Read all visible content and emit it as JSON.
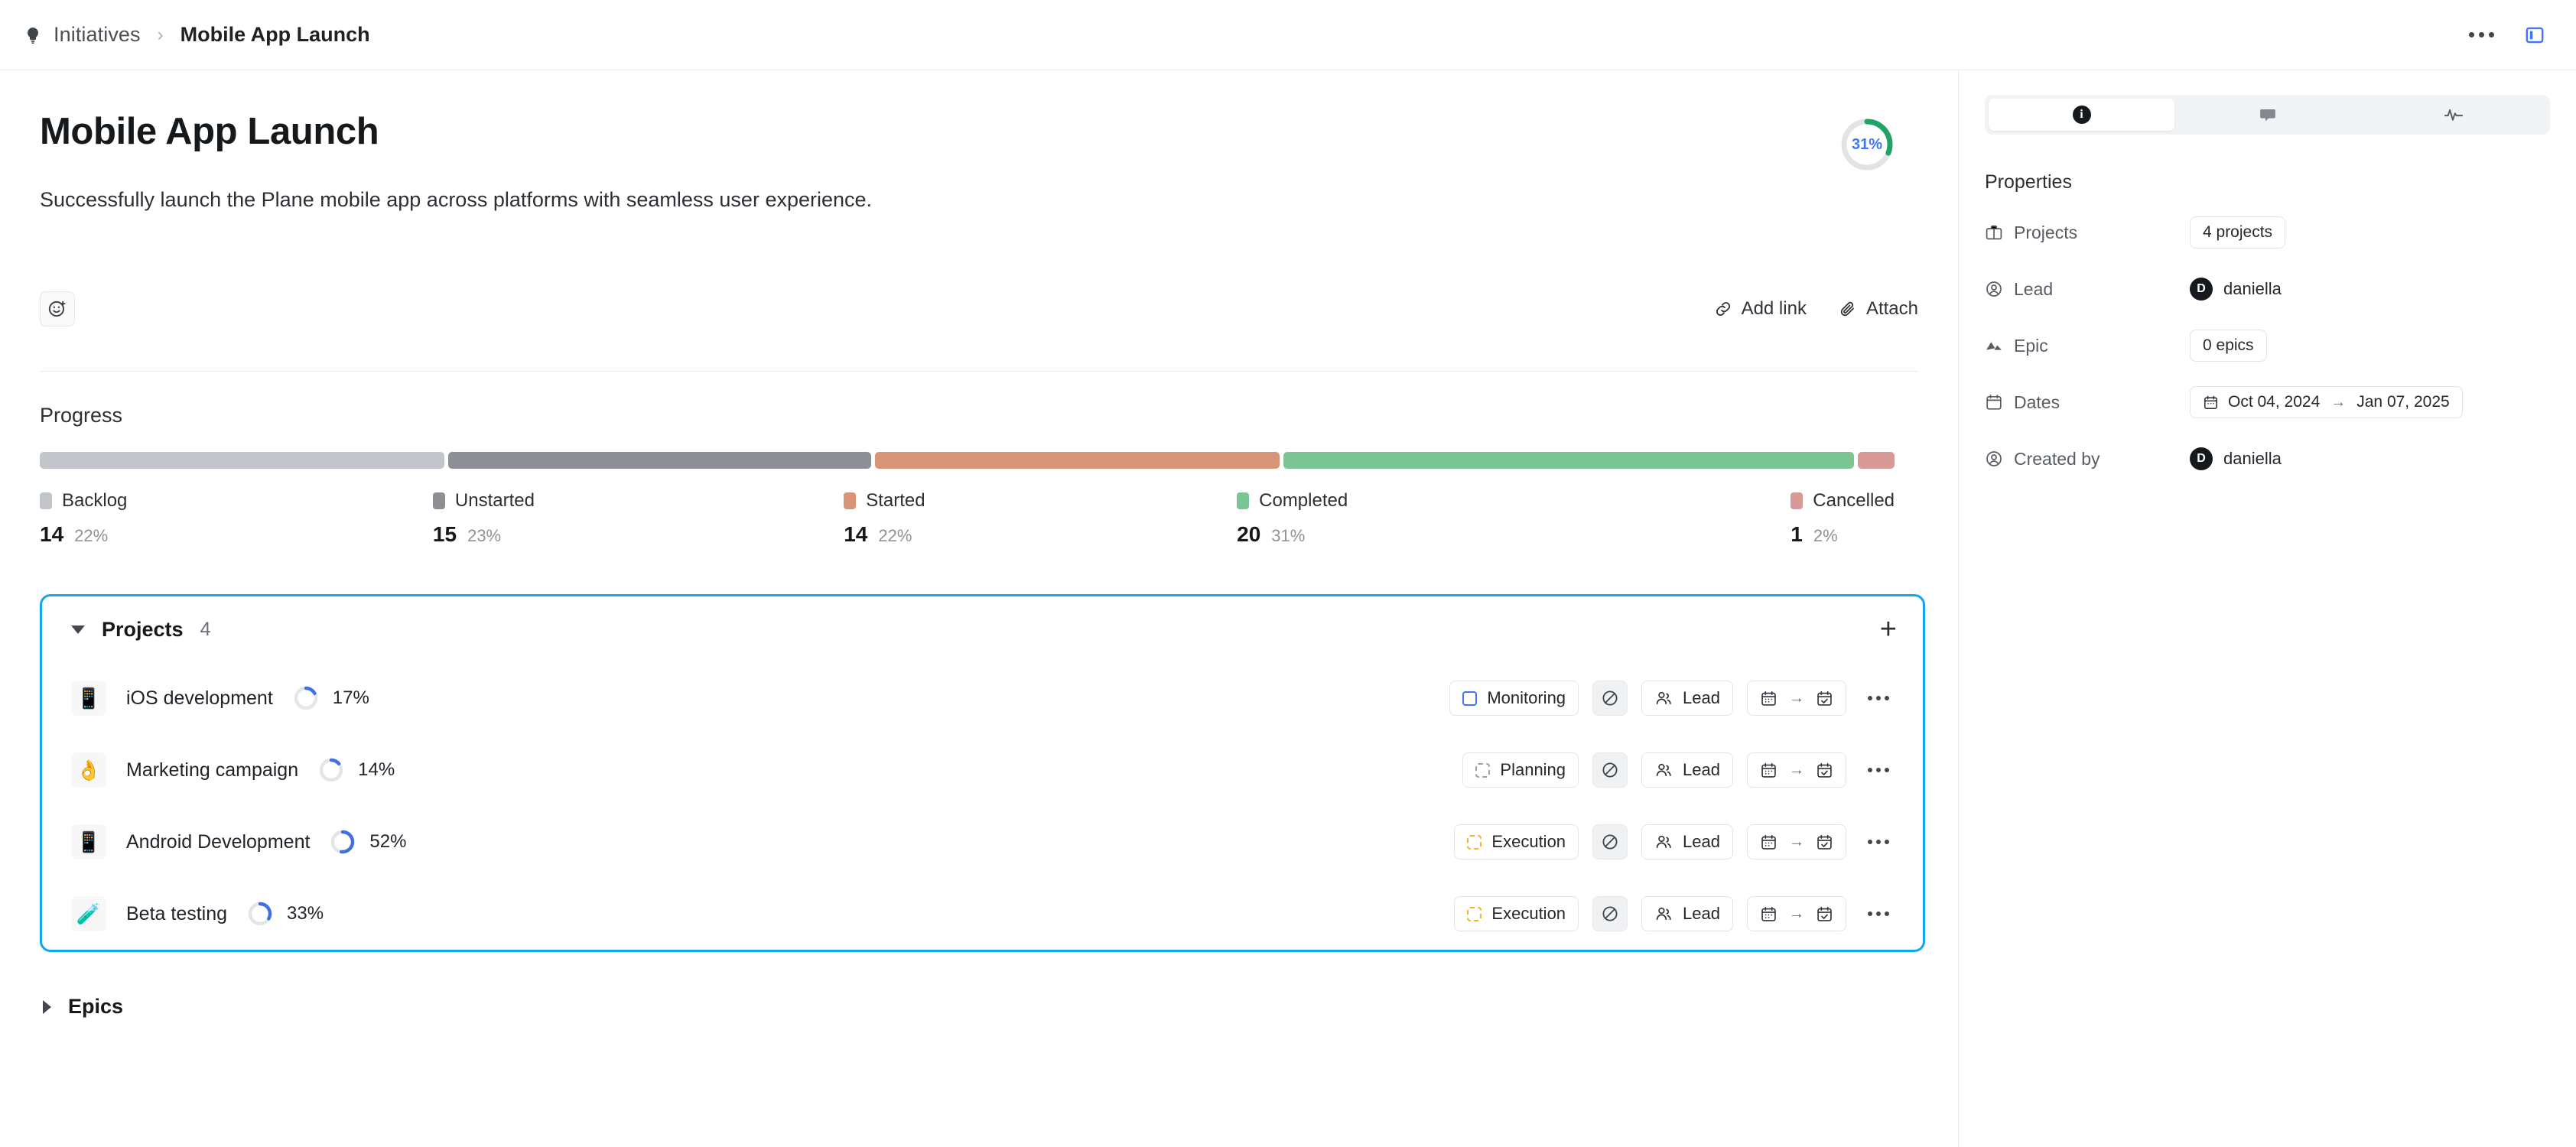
{
  "breadcrumb": {
    "icon": "lightbulb-icon",
    "parent": "Initiatives",
    "separator": "›",
    "current": "Mobile App Launch"
  },
  "topbar": {
    "more_icon": "ellipsis-icon",
    "panel_toggle_icon": "sidebar-panel-icon",
    "panel_toggle_color": "#3f76ff"
  },
  "header": {
    "title": "Mobile App Launch",
    "description": "Successfully launch the Plane mobile app across platforms with seamless user experience.",
    "progress_percent": "31%",
    "progress_value": 31,
    "ring_color": "#21a366",
    "ring_track_color": "#e1e3e5",
    "ring_text_color": "#3f76ff"
  },
  "actions": {
    "emoji_button_icon": "emoji-add-icon",
    "add_link_label": "Add link",
    "add_link_icon": "link-icon",
    "attach_label": "Attach",
    "attach_icon": "paperclip-icon"
  },
  "progress": {
    "title": "Progress",
    "states": [
      {
        "name": "Backlog",
        "count": "14",
        "percent": "22%",
        "value": 22,
        "color": "#c2c6ca"
      },
      {
        "name": "Unstarted",
        "count": "15",
        "percent": "23%",
        "value": 23,
        "color": "#8c9094"
      },
      {
        "name": "Started",
        "count": "14",
        "percent": "22%",
        "value": 22,
        "color": "#d79476"
      },
      {
        "name": "Completed",
        "count": "20",
        "percent": "31%",
        "value": 31,
        "color": "#7cc594"
      },
      {
        "name": "Cancelled",
        "count": "1",
        "percent": "2%",
        "value": 2,
        "color": "#d79a96"
      }
    ]
  },
  "projects_panel": {
    "title": "Projects",
    "count": "4",
    "collapse_icon": "caret-down-icon",
    "add_icon": "plus-icon",
    "rows": [
      {
        "emoji": "📱",
        "name": "iOS development",
        "percent": "17%",
        "value": 17,
        "state": "Monitoring",
        "state_style": "solidblue",
        "priority_icon": "no-priority-icon",
        "members_label": "Lead",
        "members_icon": "users-icon",
        "date_start_icon": "calendar-icon",
        "date_end_icon": "calendar-check-icon",
        "menu_icon": "ellipsis-icon"
      },
      {
        "emoji": "👌",
        "name": "Marketing campaign",
        "percent": "14%",
        "value": 14,
        "state": "Planning",
        "state_style": "dashgray",
        "priority_icon": "no-priority-icon",
        "members_label": "Lead",
        "members_icon": "users-icon",
        "date_start_icon": "calendar-icon",
        "date_end_icon": "calendar-check-icon",
        "menu_icon": "ellipsis-icon"
      },
      {
        "emoji": "📱",
        "name": "Android Development",
        "percent": "52%",
        "value": 52,
        "state": "Execution",
        "state_style": "dashamber",
        "priority_icon": "no-priority-icon",
        "members_label": "Lead",
        "members_icon": "users-icon",
        "date_start_icon": "calendar-icon",
        "date_end_icon": "calendar-check-icon",
        "menu_icon": "ellipsis-icon"
      },
      {
        "emoji": "🧪",
        "name": "Beta testing",
        "percent": "33%",
        "value": 33,
        "state": "Execution",
        "state_style": "dashamber",
        "priority_icon": "no-priority-icon",
        "members_label": "Lead",
        "members_icon": "users-icon",
        "date_start_icon": "calendar-icon",
        "date_end_icon": "calendar-check-icon",
        "menu_icon": "ellipsis-icon"
      }
    ],
    "focus_border_color": "#12a6ef"
  },
  "epics_section": {
    "title": "Epics",
    "expand_icon": "caret-right-icon"
  },
  "sidebar": {
    "tabs": [
      {
        "name": "info",
        "icon": "info-circle-icon",
        "active": true,
        "glyph": "i"
      },
      {
        "name": "comments",
        "icon": "comment-bubble-icon",
        "active": false
      },
      {
        "name": "activity",
        "icon": "activity-pulse-icon",
        "active": false
      }
    ],
    "properties_title": "Properties",
    "properties": [
      {
        "label": "Projects",
        "icon": "briefcase-icon",
        "value": "4 projects",
        "type": "pill"
      },
      {
        "label": "Lead",
        "icon": "user-circle-icon",
        "value": "daniella",
        "type": "user",
        "avatar_initial": "D"
      },
      {
        "label": "Epic",
        "icon": "mountain-icon",
        "value": "0 epics",
        "type": "pill"
      },
      {
        "label": "Dates",
        "icon": "calendar-icon",
        "type": "daterange",
        "start": "Oct 04, 2024",
        "end": "Jan 07, 2025",
        "arrow": "→"
      },
      {
        "label": "Created by",
        "icon": "user-circle-icon",
        "value": "daniella",
        "type": "user",
        "avatar_initial": "D"
      }
    ]
  }
}
